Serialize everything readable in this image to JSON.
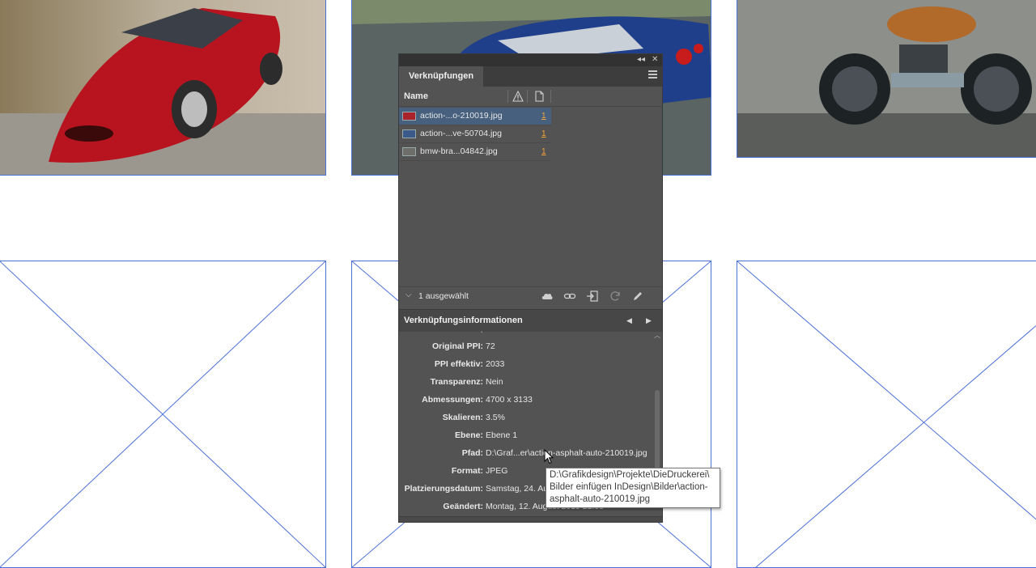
{
  "panel": {
    "collapse_icon": "◂◂",
    "close_icon": "✕",
    "tab_label": "Verknüpfungen",
    "column_name": "Name",
    "links": [
      {
        "name": "action-...o-210019.jpg",
        "count": "1",
        "selected": true
      },
      {
        "name": "action-...ve-50704.jpg",
        "count": "1",
        "selected": false
      },
      {
        "name": "bmw-bra...04842.jpg",
        "count": "1",
        "selected": false
      }
    ],
    "selection_status": "1 ausgewählt",
    "info_title": "Verknüpfungsinformationen",
    "info": [
      {
        "label": "Original PPI:",
        "value": "72"
      },
      {
        "label": "PPI effektiv:",
        "value": "2033"
      },
      {
        "label": "Transparenz:",
        "value": "Nein"
      },
      {
        "label": "Abmessungen:",
        "value": "4700 x 3133"
      },
      {
        "label": "Skalieren:",
        "value": "3.5%"
      },
      {
        "label": "Ebene:",
        "value": "Ebene 1"
      },
      {
        "label": "Pfad:",
        "value": "D:\\Graf...er\\action-asphalt-auto-210019.jpg"
      },
      {
        "label": "Format:",
        "value": "JPEG"
      },
      {
        "label": "Platzierungsdatum:",
        "value": "Samstag, 24. Au"
      },
      {
        "label": "Geändert:",
        "value": "Montag, 12. August 2019 21:08"
      }
    ]
  },
  "tooltip": {
    "line1": "D:\\Grafikdesign\\Projekte\\DieDruckerei\\",
    "line2": "Bilder einfügen InDesign\\Bilder\\action-",
    "line3": "asphalt-auto-210019.jpg"
  },
  "colors": {
    "panel_bg": "#535353",
    "selection": "#46607e",
    "link_count": "#f3a33a",
    "frame_stroke": "#4a6fd6"
  }
}
